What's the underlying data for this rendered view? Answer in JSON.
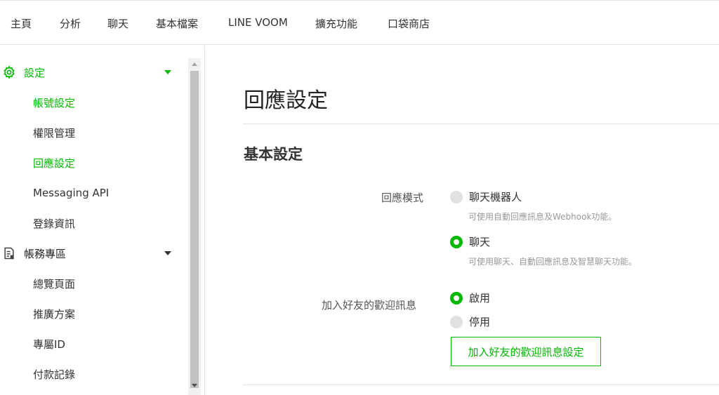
{
  "topnav": {
    "items": [
      "主頁",
      "分析",
      "聊天",
      "基本檔案",
      "LINE VOOM",
      "擴充功能",
      "口袋商店"
    ]
  },
  "sidebar": {
    "settings_group": "設定",
    "settings_items": [
      "帳號設定",
      "權限管理",
      "回應設定",
      "Messaging API",
      "登錄資訊"
    ],
    "billing_group": "帳務專區",
    "billing_items": [
      "總覽頁面",
      "推廣方案",
      "專屬ID",
      "付款記錄"
    ]
  },
  "main": {
    "title": "回應設定",
    "section": "基本設定",
    "response_mode": {
      "label": "回應模式",
      "options": [
        {
          "label": "聊天機器人",
          "hint": "可使用自動回應訊息及Webhook功能。",
          "selected": false
        },
        {
          "label": "聊天",
          "hint": "可使用聊天、自動回應訊息及智慧聊天功能。",
          "selected": true
        }
      ]
    },
    "welcome": {
      "label": "加入好友的歡迎訊息",
      "options": [
        {
          "label": "啟用",
          "selected": true
        },
        {
          "label": "停用",
          "selected": false
        }
      ],
      "button": "加入好友的歡迎訊息設定"
    }
  },
  "colors": {
    "accent": "#00b900",
    "text": "#333333",
    "muted": "#999999",
    "border": "#e6e6e6"
  },
  "icons": {
    "settings": "gear-icon",
    "billing": "receipt-icon",
    "expand": "caret-down-icon"
  }
}
